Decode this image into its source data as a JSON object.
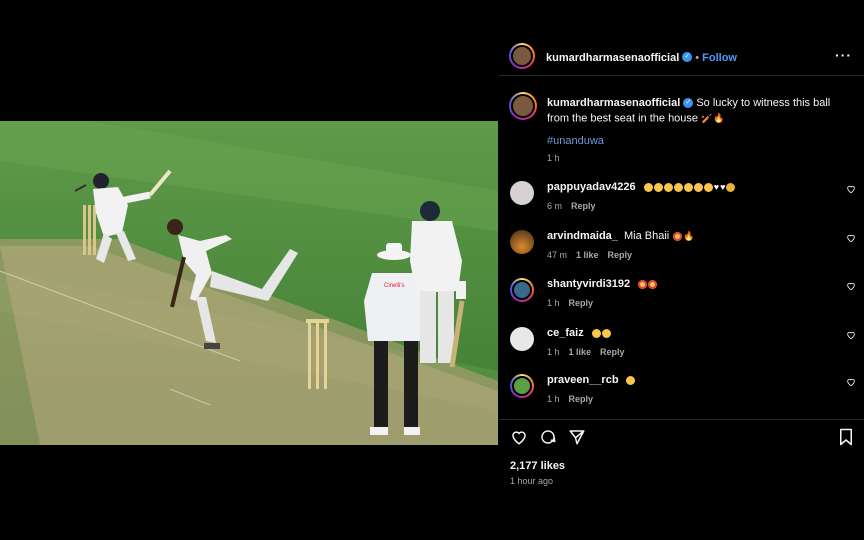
{
  "post": {
    "author": "kumardharmasenaofficial",
    "follow_label": "Follow",
    "separator": "•",
    "more_label": "···",
    "caption": "So lucky to witness this ball from the best seat in the house",
    "hashtag": "#unanduwa",
    "caption_time": "1 h",
    "likes": "2,177 likes",
    "posted": "1 hour ago"
  },
  "comments": [
    {
      "user": "pappuyadav4226",
      "text": "",
      "time": "6 m",
      "likes": "",
      "reply": "Reply"
    },
    {
      "user": "arvindmaida_",
      "text": "Mia Bhaii",
      "time": "47 m",
      "likes": "1 like",
      "reply": "Reply"
    },
    {
      "user": "shantyvirdi3192",
      "text": "",
      "time": "1 h",
      "likes": "",
      "reply": "Reply"
    },
    {
      "user": "ce_faiz",
      "text": "",
      "time": "1 h",
      "likes": "1 like",
      "reply": "Reply"
    },
    {
      "user": "praveen__rcb",
      "text": "",
      "time": "1 h",
      "likes": "",
      "reply": "Reply"
    }
  ],
  "icons": {
    "like": "heart-icon",
    "comment": "comment-icon",
    "share": "share-icon",
    "save": "bookmark-icon",
    "verified": "verified-badge-icon"
  },
  "media_text": {
    "umpire_shirt": "Cinelli's"
  },
  "colors": {
    "follow": "#4c9bf5",
    "hashtag": "#6f97d6",
    "panel_bg": "#000000",
    "meta": "#a8a8a8",
    "grass": "#4c8a3c"
  }
}
